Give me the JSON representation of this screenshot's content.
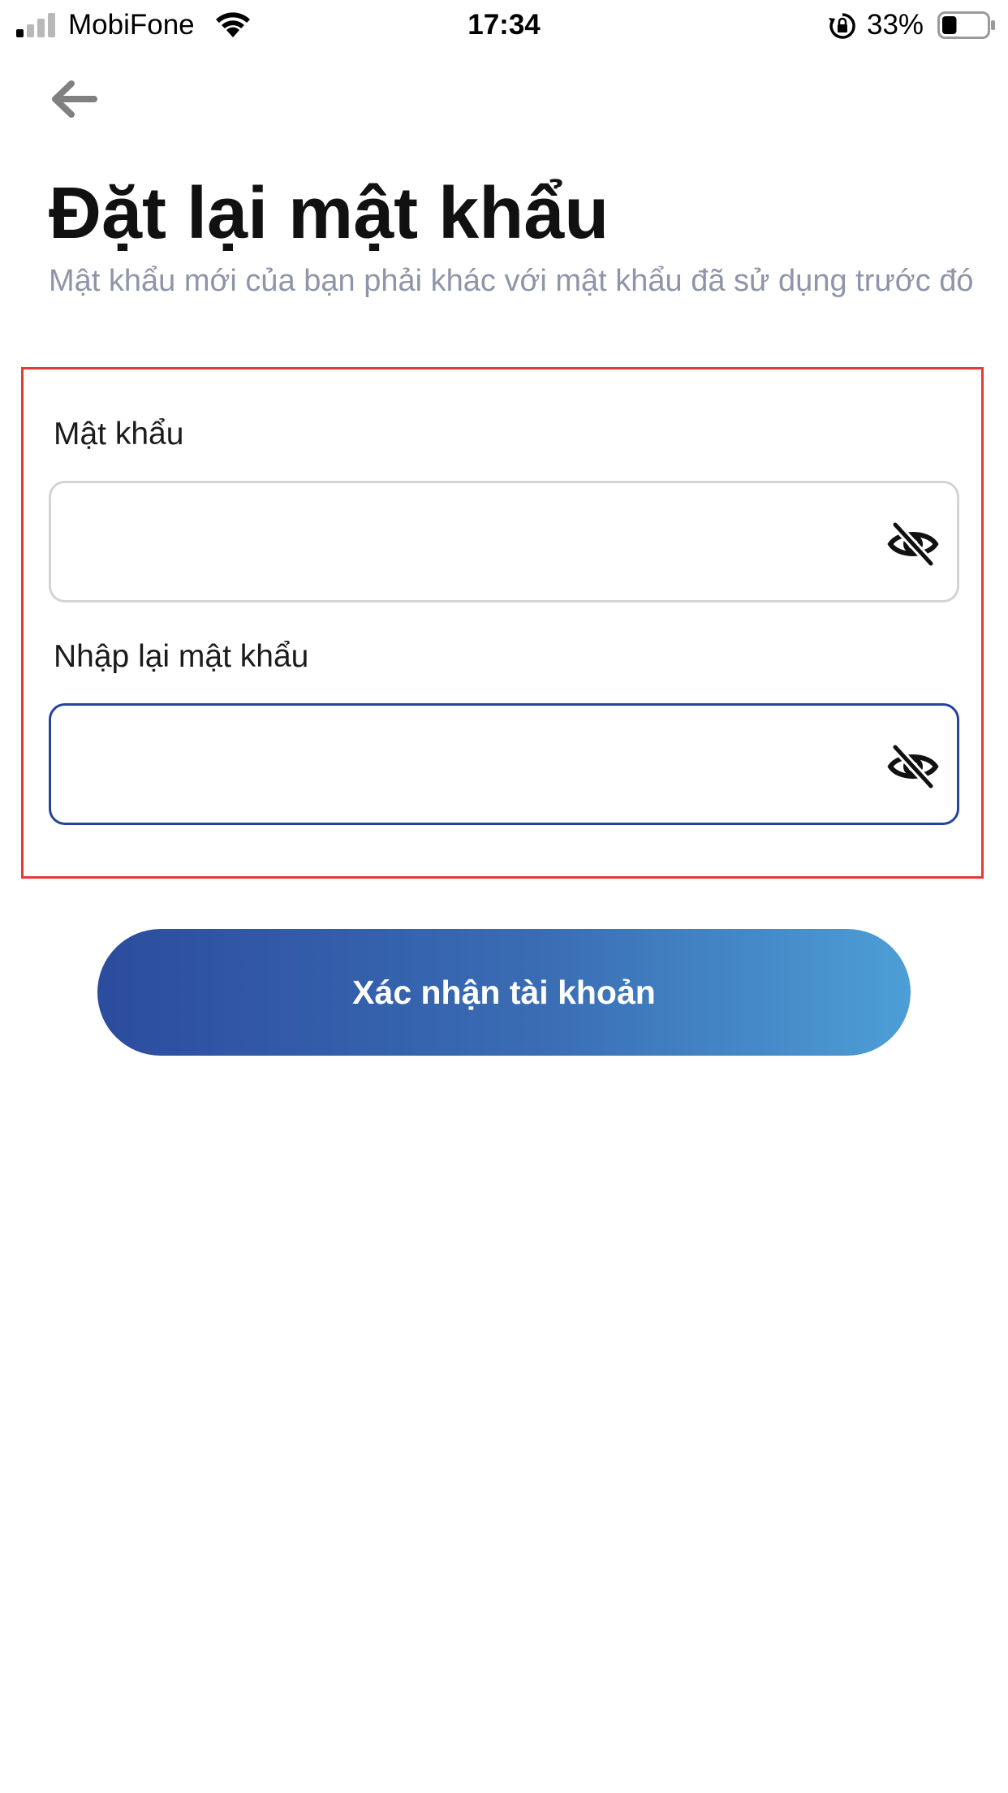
{
  "status_bar": {
    "carrier": "MobiFone",
    "time": "17:34",
    "battery_percent": "33%",
    "battery_level": 0.33,
    "signal_icon": "signal-icon",
    "wifi_icon": "wifi-icon",
    "rotation_lock_icon": "rotation-lock-icon",
    "battery_icon": "battery-icon"
  },
  "header": {
    "back_icon": "arrow-left-icon",
    "title": "Đặt lại mật khẩu",
    "subtitle": " Mật khẩu mới của bạn phải khác với mật khẩu đã sử dụng trước đó"
  },
  "form": {
    "password_label": "Mật khẩu",
    "password_value": "",
    "confirm_label": "Nhập lại mật khẩu",
    "confirm_value": "",
    "toggle_icon": "eye-off-icon",
    "highlight_color": "#e53935",
    "active_border_color": "#24449c"
  },
  "actions": {
    "confirm_label": "Xác nhận tài khoản",
    "gradient": [
      "#2c4c9e",
      "#4d9ed6"
    ]
  }
}
